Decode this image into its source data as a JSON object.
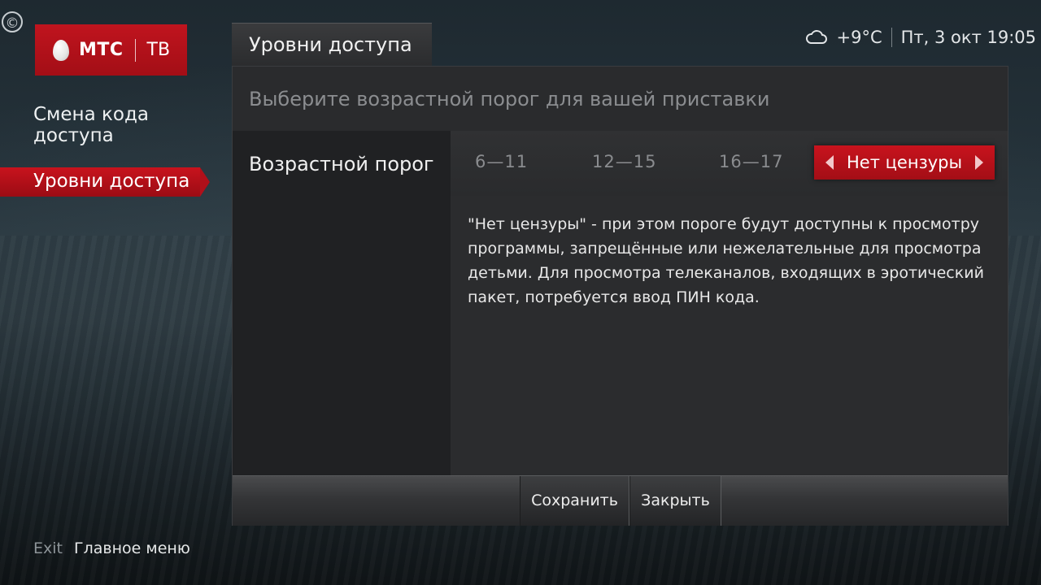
{
  "brand": {
    "name": "МТС",
    "product": "ТВ"
  },
  "copyright_symbol": "©",
  "sidebar": {
    "items": [
      {
        "label": "Смена кода доступа",
        "active": false
      },
      {
        "label": "Уровни доступа",
        "active": true
      }
    ]
  },
  "status": {
    "weather_icon": "cloud-icon",
    "temperature": "+9°C",
    "datetime": "Пт, 3 окт 19:05"
  },
  "tab": {
    "title": "Уровни доступа"
  },
  "panel": {
    "subtitle": "Выберите возрастной порог для вашей приставки",
    "setting_label": "Возрастной порог",
    "options": [
      "6—11",
      "12—15",
      "16—17",
      "Нет цензуры"
    ],
    "selected": "Нет цензуры",
    "description": "\"Нет цензуры\" - при этом пороге будут доступны к просмотру программы, запрещённые или нежелательные для просмотра детьми. Для просмотра телеканалов, входящих в эротический пакет, потребуется ввод ПИН кода."
  },
  "buttons": {
    "save": "Сохранить",
    "close": "Закрыть"
  },
  "footer": {
    "key": "Exit",
    "action": "Главное меню"
  },
  "colors": {
    "accent": "#c8131d",
    "panel_bg": "#1c1d1f"
  }
}
